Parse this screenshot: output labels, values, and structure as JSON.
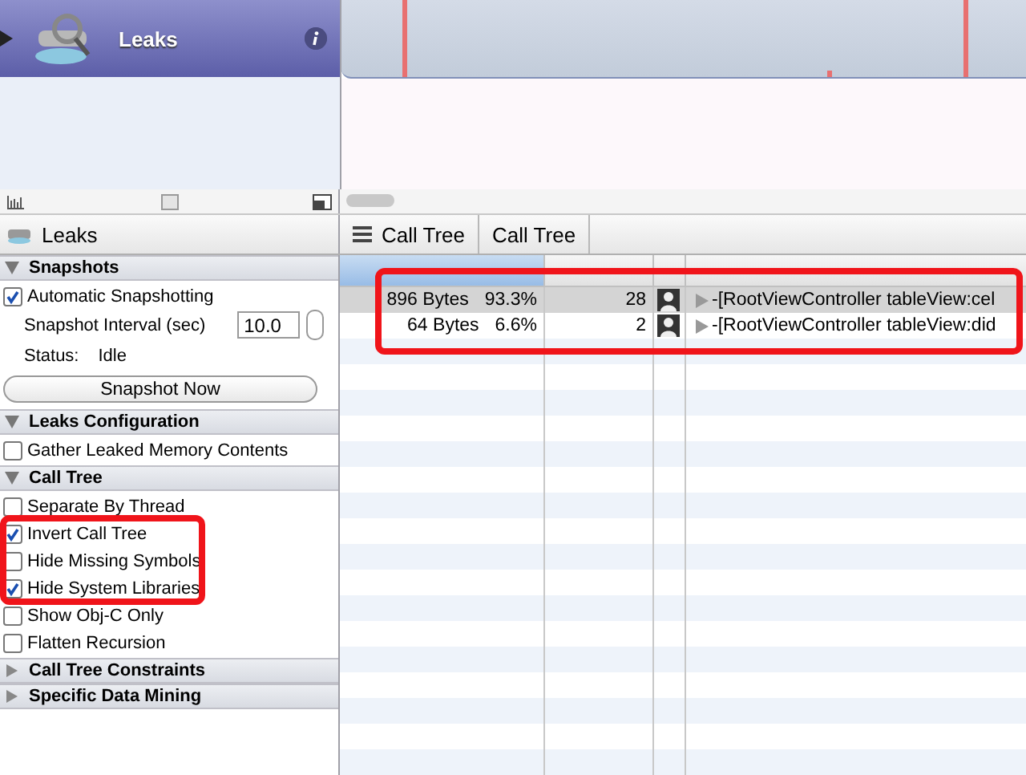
{
  "track": {
    "title": "Leaks"
  },
  "inspector": {
    "title": "Leaks",
    "sections": [
      {
        "title": "Snapshots",
        "expanded": true,
        "items": [
          {
            "kind": "checkbox",
            "label": "Automatic Snapshotting",
            "checked": true
          },
          {
            "kind": "stepper",
            "label": "Snapshot Interval (sec)",
            "value": "10.0"
          },
          {
            "kind": "status",
            "label": "Status:",
            "value": "Idle"
          },
          {
            "kind": "button",
            "label": "Snapshot Now"
          }
        ]
      },
      {
        "title": "Leaks Configuration",
        "expanded": true,
        "items": [
          {
            "kind": "checkbox",
            "label": "Gather Leaked Memory Contents",
            "checked": false
          }
        ]
      },
      {
        "title": "Call Tree",
        "expanded": true,
        "items": [
          {
            "kind": "checkbox",
            "label": "Separate By Thread",
            "checked": false
          },
          {
            "kind": "checkbox",
            "label": "Invert Call Tree",
            "checked": true
          },
          {
            "kind": "checkbox",
            "label": "Hide Missing Symbols",
            "checked": false
          },
          {
            "kind": "checkbox",
            "label": "Hide System Libraries",
            "checked": true
          },
          {
            "kind": "checkbox",
            "label": "Show Obj-C Only",
            "checked": false
          },
          {
            "kind": "checkbox",
            "label": "Flatten Recursion",
            "checked": false
          }
        ]
      },
      {
        "title": "Call Tree Constraints",
        "expanded": false
      },
      {
        "title": "Specific Data Mining",
        "expanded": false
      }
    ]
  },
  "breadcrumb": [
    {
      "label": "Call Tree"
    },
    {
      "label": "Call Tree"
    }
  ],
  "table": {
    "rows": [
      {
        "bytes": "896 Bytes",
        "percent": "93.3%",
        "leaks": "28",
        "symbol": "-[RootViewController tableView:cel",
        "selected": true
      },
      {
        "bytes": "64 Bytes",
        "percent": "6.6%",
        "leaks": "2",
        "symbol": "-[RootViewController tableView:did",
        "selected": false
      }
    ]
  }
}
